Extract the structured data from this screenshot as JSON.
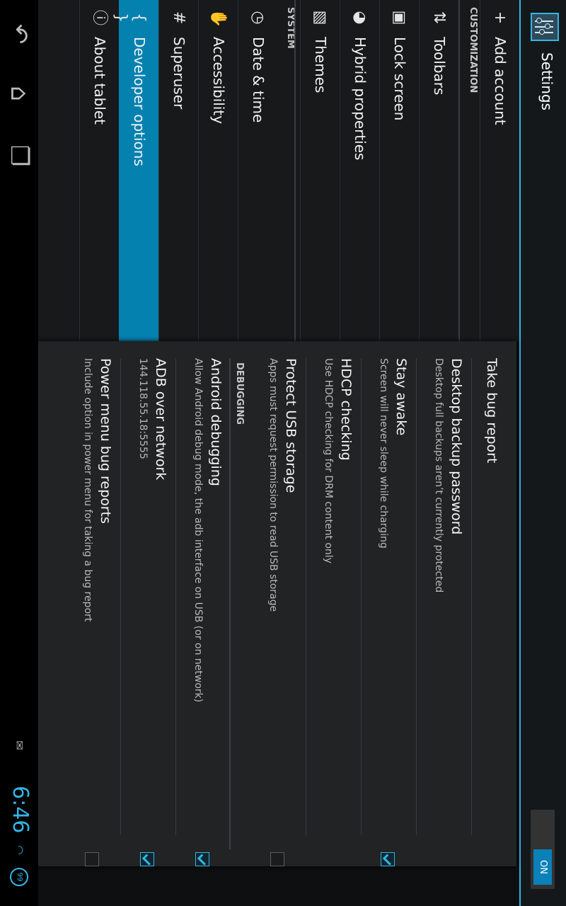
{
  "action_bar": {
    "title": "Settings",
    "toggle_label": "ON"
  },
  "headers": {
    "add_account": "Add account",
    "customization_label": "CUSTOMIZATION",
    "toolbars": "Toolbars",
    "lock_screen": "Lock screen",
    "hybrid_properties": "Hybrid properties",
    "themes": "Themes",
    "system_label": "SYSTEM",
    "date_time": "Date & time",
    "accessibility": "Accessibility",
    "superuser": "Superuser",
    "developer_options": "Developer options",
    "about_tablet": "About tablet",
    "developer_icon_glyph": "{ }",
    "superuser_icon_glyph": "#"
  },
  "developer": {
    "take_bug_report": "Take bug report",
    "desktop_backup_title": "Desktop backup password",
    "desktop_backup_summary": "Desktop full backups aren’t currently protected",
    "stay_awake_title": "Stay awake",
    "stay_awake_summary": "Screen will never sleep while charging",
    "stay_awake_checked": true,
    "hdcp_title": "HDCP checking",
    "hdcp_summary": "Use HDCP checking for DRM content only",
    "protect_usb_title": "Protect USB storage",
    "protect_usb_summary": "Apps must request permission to read USB storage",
    "protect_usb_checked": false,
    "debugging_label": "DEBUGGING",
    "android_debugging_title": "Android debugging",
    "android_debugging_summary": "Allow Android debug mode, the adb interface on USB (or on network)",
    "android_debugging_checked": true,
    "adb_network_title": "ADB over network",
    "adb_network_summary": "144.118.55.18:5555",
    "adb_network_checked": true,
    "power_menu_title": "Power menu bug reports",
    "power_menu_summary": "Include option in power menu for taking a bug report",
    "power_menu_checked": false
  },
  "status_bar": {
    "time": "6:46",
    "battery_level": "99"
  },
  "colors": {
    "accent": "#33b5e5",
    "selected": "#0581b0"
  },
  "icons": [
    "settings-icon",
    "plus-icon",
    "toolbar-icon",
    "lock-icon",
    "hybrid-icon",
    "themes-icon",
    "clock-icon",
    "hand-icon",
    "hash-icon",
    "braces-icon",
    "info-icon",
    "back-icon",
    "home-icon",
    "recents-icon",
    "gmail-icon",
    "wifi-icon",
    "battery-icon"
  ]
}
